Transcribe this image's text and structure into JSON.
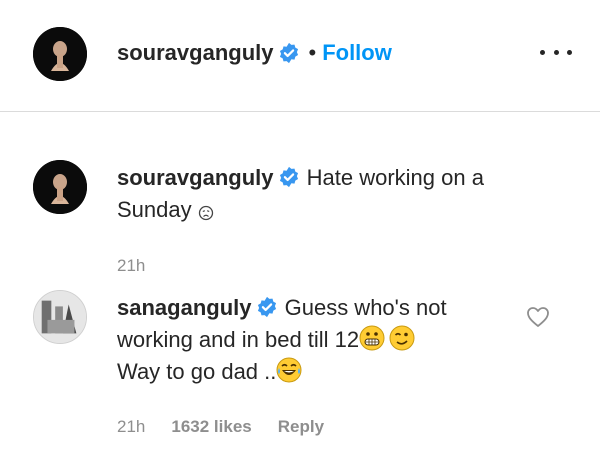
{
  "header": {
    "username": "souravganguly",
    "separator": "•",
    "follow_label": "Follow"
  },
  "caption": {
    "username": "souravganguly",
    "text": "Hate working on a Sunday",
    "time": "21h"
  },
  "comment": {
    "username": "sanaganguly",
    "text_line1": "Guess who's not",
    "text_line2": "working and in bed till 12",
    "text_line3": "Way to go dad ..",
    "time": "21h",
    "likes": "1632 likes",
    "reply_label": "Reply"
  },
  "icons": {
    "verified": "verified-badge-icon",
    "more": "more-options-icon",
    "heart": "heart-icon"
  },
  "colors": {
    "accent": "#0095f6",
    "verified": "#3897f0",
    "meta": "#8e8e8e"
  }
}
